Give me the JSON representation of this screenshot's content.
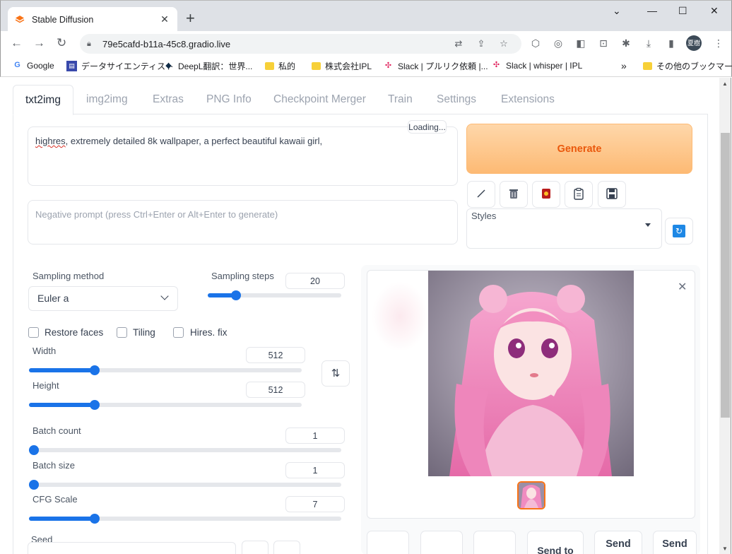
{
  "browser": {
    "tab_title": "Stable Diffusion",
    "url": "79e5cafd-b11a-45c8.gradio.live",
    "avatar_text": "夏樹",
    "bookmarks": [
      "Google",
      "データサイエンティスト",
      "DeepL翻訳：世界...",
      "私的",
      "株式会社IPL",
      "Slack | プルリク依頼 |...",
      "Slack | whisper | IPL",
      "その他のブックマーク"
    ],
    "more_bookmarks": "»"
  },
  "nav_tabs": [
    "txt2img",
    "img2img",
    "Extras",
    "PNG Info",
    "Checkpoint Merger",
    "Train",
    "Settings",
    "Extensions"
  ],
  "prompt": {
    "misspelled_word": "highres",
    "rest": ", extremely detailed 8k wallpaper, a perfect beautiful kawaii girl,",
    "token_counter": "Loading..."
  },
  "negative_prompt": {
    "placeholder": "Negative prompt (press Ctrl+Enter or Alt+Enter to generate)"
  },
  "generate_label": "Generate",
  "styles_label": "Styles",
  "sampling": {
    "method_label": "Sampling method",
    "method_value": "Euler a",
    "steps_label": "Sampling steps",
    "steps_value": "20",
    "steps_fraction": 0.19
  },
  "checkboxes": [
    "Restore faces",
    "Tiling",
    "Hires. fix"
  ],
  "width": {
    "label": "Width",
    "value": "512",
    "fraction": 0.23
  },
  "height": {
    "label": "Height",
    "value": "512",
    "fraction": 0.23
  },
  "batch_count": {
    "label": "Batch count",
    "value": "1",
    "fraction": 0.0
  },
  "batch_size": {
    "label": "Batch size",
    "value": "1",
    "fraction": 0.0
  },
  "cfg": {
    "label": "CFG Scale",
    "value": "7",
    "fraction": 0.2
  },
  "seed_label": "Seed",
  "swap_icon": "⇅",
  "bottom_buttons": [
    "",
    "",
    "",
    "Send to",
    "Send",
    "Send"
  ]
}
